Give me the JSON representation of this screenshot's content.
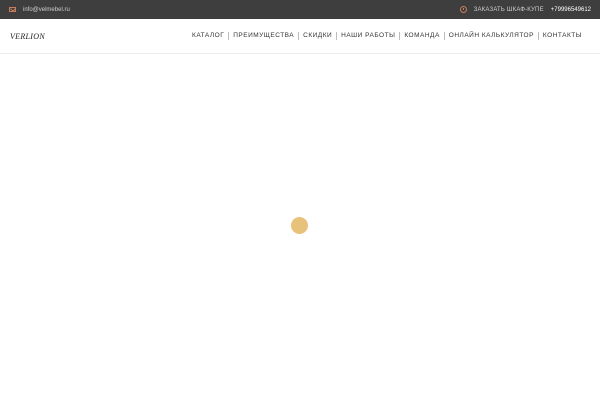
{
  "topbar": {
    "email": "info@velmebel.ru",
    "order_label": "ЗАКАЗАТЬ ШКАФ-КУПЕ",
    "phone": "+79996549612"
  },
  "header": {
    "logo_text": "VERLION"
  },
  "nav": {
    "items": [
      "КАТАЛОГ",
      "ПРЕИМУЩЕСТВА",
      "СКИДКИ",
      "НАШИ РАБОТЫ",
      "КОМАНДА",
      "ОНЛАЙН КАЛЬКУЛЯТОР",
      "КОНТАКТЫ"
    ]
  },
  "icons": {
    "mail": "mail-icon",
    "clock": "clock-icon",
    "loader": "loading-spinner"
  },
  "colors": {
    "topbar_bg": "#3e3e3e",
    "accent": "#c97d5e",
    "loader": "#e8c17b"
  }
}
